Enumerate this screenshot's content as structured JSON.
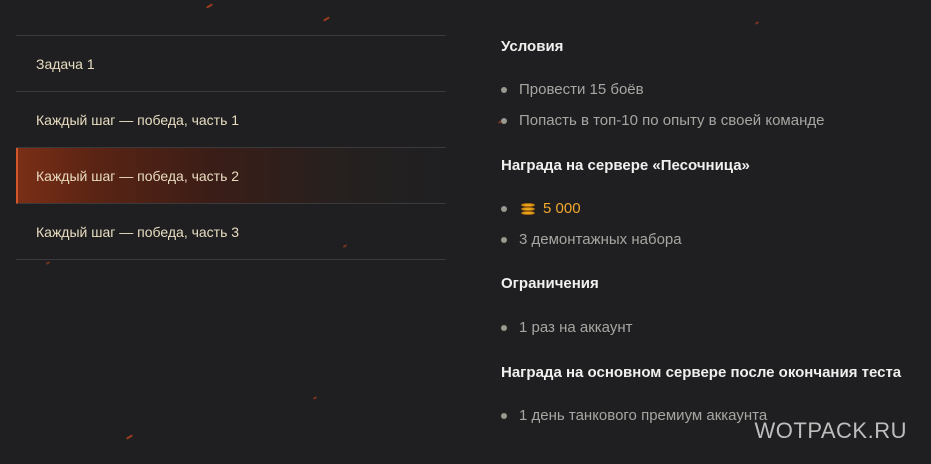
{
  "tasks": [
    {
      "label": "Задача 1",
      "active": false
    },
    {
      "label": "Каждый шаг — победа, часть 1",
      "active": false
    },
    {
      "label": "Каждый шаг — победа, часть 2",
      "active": true
    },
    {
      "label": "Каждый шаг — победа, часть 3",
      "active": false
    }
  ],
  "details": {
    "conditions": {
      "title": "Условия",
      "items": [
        "Провести 15 боёв",
        "Попасть в топ-10 по опыту в своей команде"
      ]
    },
    "sandbox_reward": {
      "title": "Награда на сервере «Песочница»",
      "credits": "5 000",
      "credits_icon": "credits-coin-icon",
      "item": "3 демонтажных набора"
    },
    "restrictions": {
      "title": "Ограничения",
      "items": [
        "1 раз на аккаунт"
      ]
    },
    "main_reward": {
      "title": "Награда на основном сервере после окончания теста",
      "items": [
        "1 день танкового премиум аккаунта"
      ]
    }
  },
  "watermark": "WOTPACK.RU",
  "colors": {
    "background": "#1f1f21",
    "active_accent": "#d2562a",
    "gold": "#f1a82d",
    "task_text": "#e8dcc0"
  }
}
